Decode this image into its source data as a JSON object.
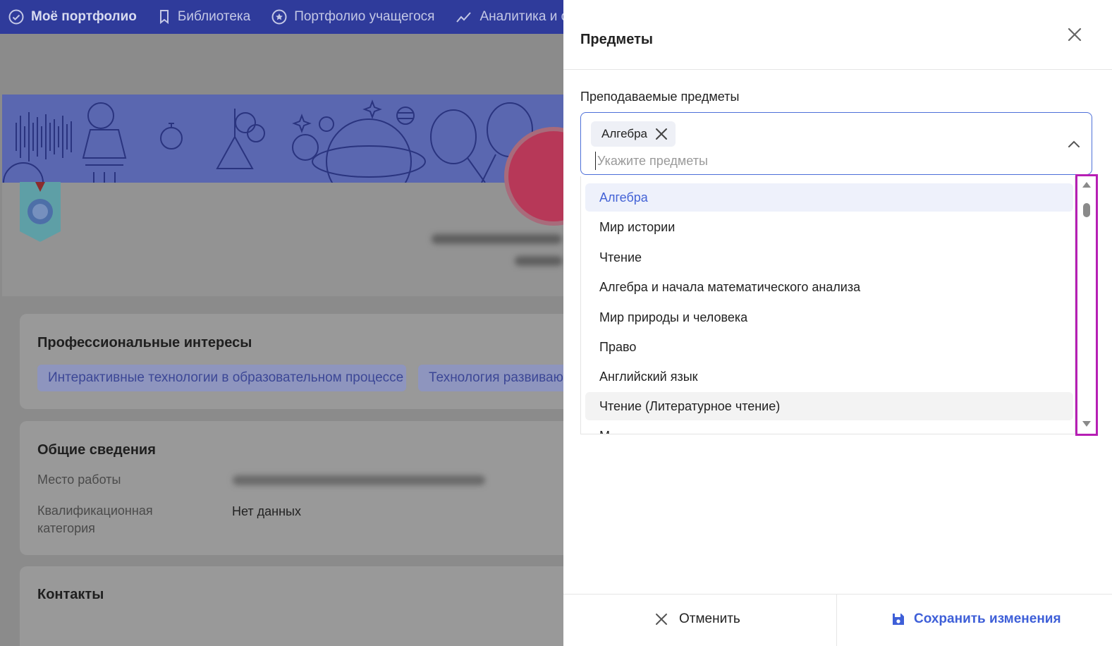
{
  "nav": {
    "items": [
      {
        "label": "Моё портфолио",
        "icon": "check-circle-icon"
      },
      {
        "label": "Библиотека",
        "icon": "bookmark-icon"
      },
      {
        "label": "Портфолио учащегося",
        "icon": "star-circle-icon"
      },
      {
        "label": "Аналитика и отч",
        "icon": "chart-line-icon"
      }
    ]
  },
  "background": {
    "interests_title": "Профессиональные интересы",
    "interests": [
      "Интерактивные технологии в образовательном процессе",
      "Технология развиваю"
    ],
    "general_title": "Общие сведения",
    "workplace_label": "Место работы",
    "qualification_label": "Квалификационная категория",
    "qualification_value": "Нет данных",
    "contacts_title": "Контакты"
  },
  "panel": {
    "title": "Предметы",
    "field_label": "Преподаваемые предметы",
    "selected_tags": [
      "Алгебра"
    ],
    "input_placeholder": "Укажите предметы",
    "options": [
      {
        "label": "Алгебра",
        "state": "selected"
      },
      {
        "label": "Мир истории",
        "state": ""
      },
      {
        "label": "Чтение",
        "state": ""
      },
      {
        "label": "Алгебра и начала математического анализа",
        "state": ""
      },
      {
        "label": "Мир природы и человека",
        "state": ""
      },
      {
        "label": "Право",
        "state": ""
      },
      {
        "label": "Английский язык",
        "state": ""
      },
      {
        "label": "Чтение (Литературное чтение)",
        "state": "hover"
      },
      {
        "label": "М",
        "state": ""
      }
    ],
    "cancel_label": "Отменить",
    "save_label": "Сохранить изменения"
  },
  "colors": {
    "accent": "#3e5fd8",
    "nav_bg": "#2f3b9b",
    "highlight": "#b61fb4"
  }
}
